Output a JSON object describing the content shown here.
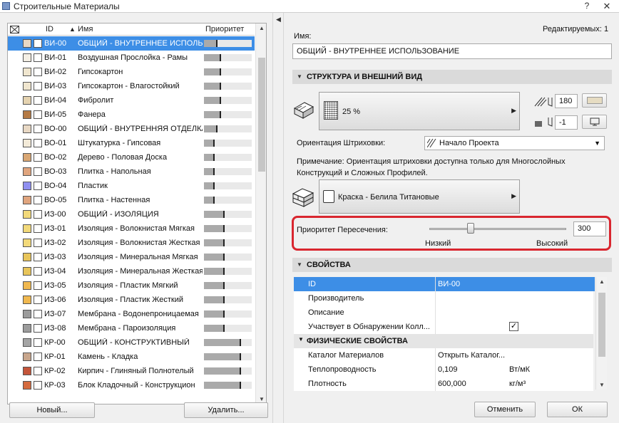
{
  "window": {
    "title": "Строительные Материалы",
    "help_glyph": "?",
    "close_glyph": "✕"
  },
  "list": {
    "headers": {
      "id": "ID",
      "name": "Имя",
      "priority": "Приоритет"
    },
    "rows": [
      {
        "id": "ВИ-00",
        "name": "ОБЩИЙ - ВНУТРЕННЕЕ ИСПОЛЬЗОВА",
        "priority": 0.25,
        "fill_color": "#e8d8c4",
        "selected": true
      },
      {
        "id": "ВИ-01",
        "name": "Воздушная Прослойка - Рамы",
        "priority": 0.33,
        "fill_color": "#f5efe4",
        "selected": false
      },
      {
        "id": "ВИ-02",
        "name": "Гипсокартон",
        "priority": 0.33,
        "fill_color": "#f0e6cf",
        "selected": false
      },
      {
        "id": "ВИ-03",
        "name": "Гипсокартон - Влагостойкий",
        "priority": 0.33,
        "fill_color": "#f0e6cf",
        "selected": false
      },
      {
        "id": "ВИ-04",
        "name": "Фибролит",
        "priority": 0.33,
        "fill_color": "#e5d3b0",
        "selected": false
      },
      {
        "id": "ВИ-05",
        "name": "Фанера",
        "priority": 0.33,
        "fill_color": "#b47a45",
        "selected": false
      },
      {
        "id": "ВО-00",
        "name": "ОБЩИЙ - ВНУТРЕННЯЯ ОТДЕЛКА",
        "priority": 0.25,
        "fill_color": "#e8d8c4",
        "selected": false
      },
      {
        "id": "ВО-01",
        "name": "Штукатурка - Гипсовая",
        "priority": 0.2,
        "fill_color": "#f3ead8",
        "selected": false
      },
      {
        "id": "ВО-02",
        "name": "Дерево - Половая Доска",
        "priority": 0.2,
        "fill_color": "#d9a774",
        "selected": false
      },
      {
        "id": "ВО-03",
        "name": "Плитка - Напольная",
        "priority": 0.2,
        "fill_color": "#e0a57e",
        "selected": false
      },
      {
        "id": "ВО-04",
        "name": "Пластик",
        "priority": 0.2,
        "fill_color": "#8f8ff0",
        "selected": false
      },
      {
        "id": "ВО-05",
        "name": "Плитка - Настенная",
        "priority": 0.2,
        "fill_color": "#e0a57e",
        "selected": false
      },
      {
        "id": "ИЗ-00",
        "name": "ОБЩИЙ - ИЗОЛЯЦИЯ",
        "priority": 0.4,
        "fill_color": "#f2d97a",
        "selected": false
      },
      {
        "id": "ИЗ-01",
        "name": "Изоляция - Волокнистая Мягкая",
        "priority": 0.4,
        "fill_color": "#f2d97a",
        "selected": false
      },
      {
        "id": "ИЗ-02",
        "name": "Изоляция - Волокнистая Жесткая",
        "priority": 0.4,
        "fill_color": "#f2d97a",
        "selected": false
      },
      {
        "id": "ИЗ-03",
        "name": "Изоляция - Минеральная Мягкая",
        "priority": 0.4,
        "fill_color": "#e8c55b",
        "selected": false
      },
      {
        "id": "ИЗ-04",
        "name": "Изоляция - Минеральная Жесткая",
        "priority": 0.4,
        "fill_color": "#e8c55b",
        "selected": false
      },
      {
        "id": "ИЗ-05",
        "name": "Изоляция - Пластик Мягкий",
        "priority": 0.4,
        "fill_color": "#f0b84f",
        "selected": false
      },
      {
        "id": "ИЗ-06",
        "name": "Изоляция - Пластик Жесткий",
        "priority": 0.4,
        "fill_color": "#f0b84f",
        "selected": false
      },
      {
        "id": "ИЗ-07",
        "name": "Мембрана - Водонепроницаемая",
        "priority": 0.4,
        "fill_color": "#9c9c9c",
        "selected": false
      },
      {
        "id": "ИЗ-08",
        "name": "Мембрана - Пароизоляция",
        "priority": 0.4,
        "fill_color": "#9c9c9c",
        "selected": false
      },
      {
        "id": "КР-00",
        "name": "ОБЩИЙ - КОНСТРУКТИВНЫЙ",
        "priority": 0.75,
        "fill_color": "#a5a5a5",
        "selected": false
      },
      {
        "id": "КР-01",
        "name": "Камень - Кладка",
        "priority": 0.75,
        "fill_color": "#c8a68c",
        "selected": false
      },
      {
        "id": "КР-02",
        "name": "Кирпич - Глиняный Полнотелый",
        "priority": 0.75,
        "fill_color": "#c4553a",
        "selected": false
      },
      {
        "id": "КР-03",
        "name": "Блок Кладочный - Конструкцион",
        "priority": 0.75,
        "fill_color": "#d46b3f",
        "selected": false
      }
    ]
  },
  "buttons": {
    "new": "Новый...",
    "delete": "Удалить...",
    "cancel": "Отменить",
    "ok": "ОК"
  },
  "editable_count": "Редактируемых: 1",
  "name_label": "Имя:",
  "name_value": "ОБЩИЙ - ВНУТРЕННЕЕ ИСПОЛЬЗОВАНИЕ",
  "structure": {
    "heading": "СТРУКТУРА И ВНЕШНИЙ ВИД",
    "fill_label": "25 %",
    "pen_value": "180",
    "bg_value": "-1",
    "orientation_label": "Ориентация Штриховки:",
    "orientation_value": "Начало Проекта",
    "note": "Примечание: Ориентация штриховки доступна только для Многослойных Конструкций и Сложных Профилей.",
    "surface_label": "Краска - Белила Титановые",
    "priority_label": "Приоритет Пересечения:",
    "priority_value": "300",
    "priority_level": 0.3,
    "low_label": "Низкий",
    "high_label": "Высокий"
  },
  "properties": {
    "heading": "СВОЙСТВА",
    "rows": [
      {
        "key": "ID",
        "value": "ВИ-00",
        "unit": "",
        "selected": true
      },
      {
        "key": "Производитель",
        "value": "",
        "unit": "",
        "selected": false
      },
      {
        "key": "Описание",
        "value": "",
        "unit": "",
        "selected": false
      },
      {
        "key": "Участвует в Обнаружении Колл...",
        "value": "",
        "unit": "",
        "selected": false
      }
    ],
    "physical_heading": "ФИЗИЧЕСКИЕ СВОЙСТВА",
    "physical_rows": [
      {
        "key": "Каталог Материалов",
        "value": "Открыть Каталог...",
        "unit": ""
      },
      {
        "key": "Теплопроводность",
        "value": "0,109",
        "unit": "Вт/мК"
      },
      {
        "key": "Плотность",
        "value": "600,000",
        "unit": "кг/м³"
      }
    ]
  }
}
